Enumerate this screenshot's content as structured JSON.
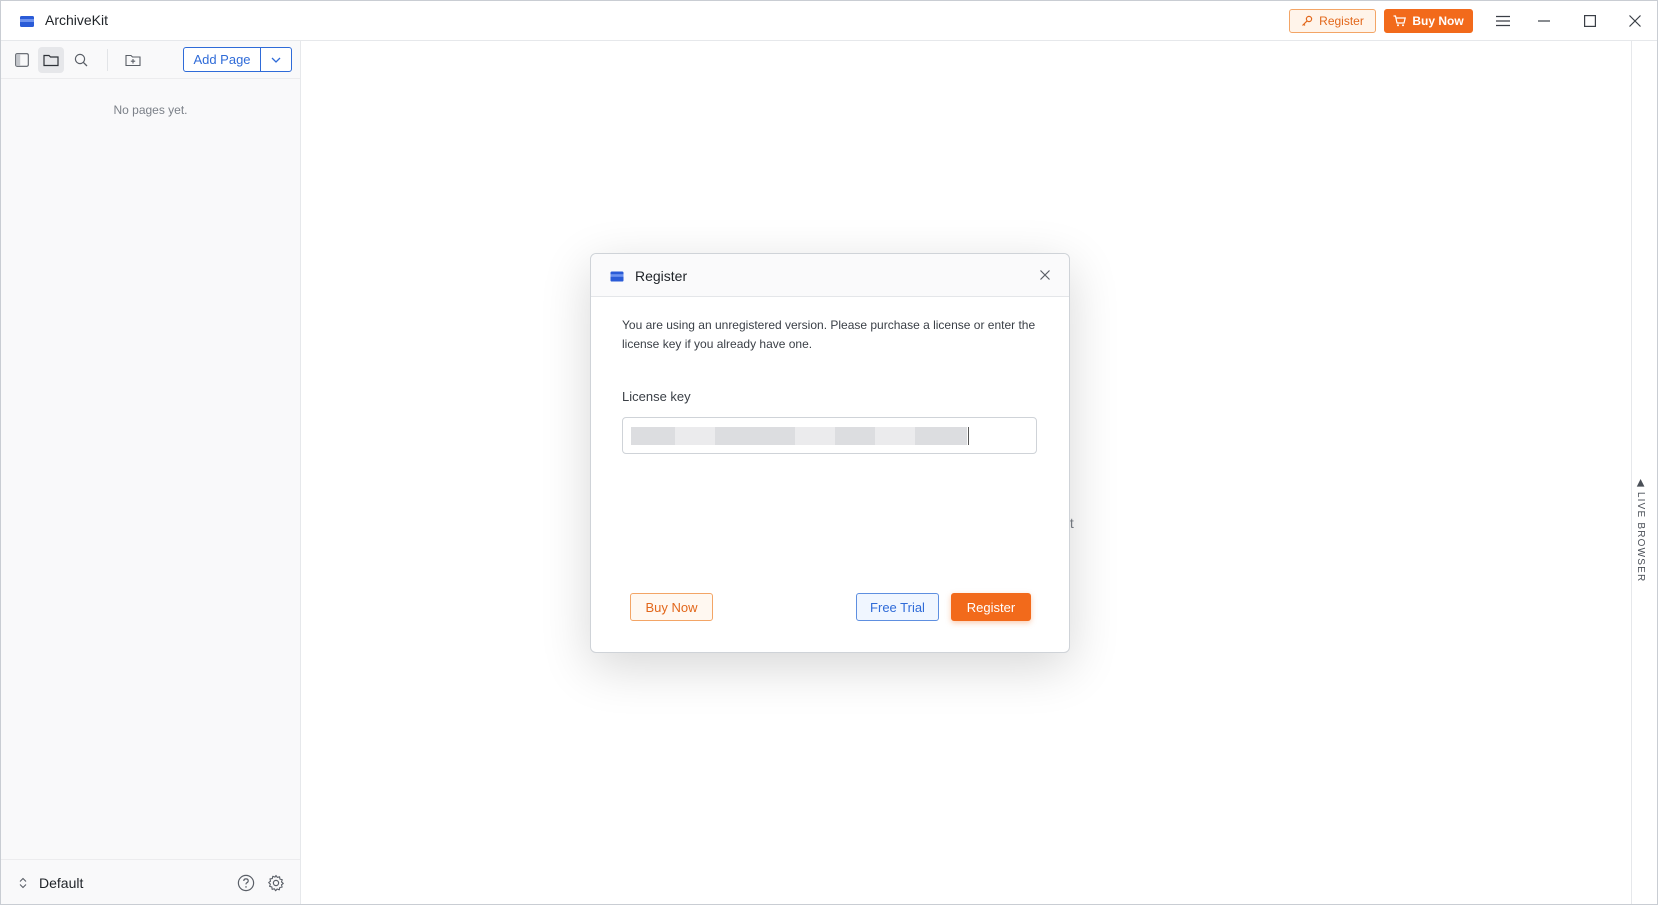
{
  "app": {
    "title": "ArchiveKit"
  },
  "titlebar": {
    "register_label": "Register",
    "buynow_label": "Buy Now",
    "icons": [
      "key-icon",
      "cart-icon",
      "menu-icon",
      "minimize-icon",
      "maximize-icon",
      "close-icon"
    ]
  },
  "sidebar": {
    "add_page_label": "Add Page",
    "empty_text": "No pages yet.",
    "vault_name": "Default",
    "icons": [
      "sidebar-toggle-icon",
      "folder-icon",
      "search-icon",
      "new-folder-icon",
      "chevron-down-icon",
      "updown-chevron-icon",
      "help-icon",
      "gear-icon"
    ]
  },
  "main": {
    "background_hint_fragment": "ult",
    "live_browser_label": "LIVE BROWSER"
  },
  "dialog": {
    "title": "Register",
    "description": "You are using an unregistered version. Please purchase a license or enter the license key if you already have one.",
    "license_key_label": "License key",
    "license_key_value_redacted": true,
    "buynow_label": "Buy Now",
    "freetrial_label": "Free Trial",
    "register_label": "Register"
  },
  "colors": {
    "accent_orange": "#f26a1b",
    "accent_blue": "#2f6bd8",
    "logo_blue": "#2a5bd7"
  }
}
